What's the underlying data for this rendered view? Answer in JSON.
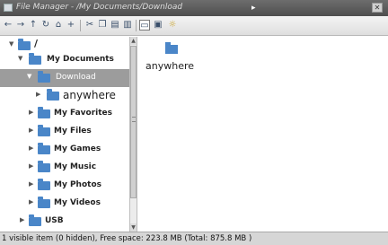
{
  "window": {
    "title": "File Manager - /My Documents/Download",
    "close_glyph": "✕",
    "app_icon": "folder-window-icon"
  },
  "toolbar": {
    "buttons": [
      {
        "name": "back-button",
        "glyph": "←"
      },
      {
        "name": "forward-button",
        "glyph": "→"
      },
      {
        "name": "up-button",
        "glyph": "↑"
      },
      {
        "name": "refresh-button",
        "glyph": "↻"
      },
      {
        "name": "home-button",
        "glyph": "⌂"
      },
      {
        "name": "new-folder-button",
        "glyph": "+"
      },
      {
        "name": "cut-button",
        "glyph": "✂"
      },
      {
        "name": "copy-button",
        "glyph": "❐"
      },
      {
        "name": "paste-button",
        "glyph": "▤"
      },
      {
        "name": "delete-button",
        "glyph": "▥"
      },
      {
        "name": "view-mode-button",
        "glyph": "▭"
      },
      {
        "name": "view-list-button",
        "glyph": "▣"
      },
      {
        "name": "hint-button",
        "glyph": "☼"
      }
    ]
  },
  "tree": [
    {
      "label": "/",
      "expanded": true,
      "icon": "folder-icon"
    },
    {
      "label": "My Documents",
      "expanded": true,
      "icon": "folder-icon"
    },
    {
      "label": "Download",
      "expanded": true,
      "selected": true,
      "icon": "folder-icon"
    },
    {
      "label": "anywhere",
      "expanded": false,
      "icon": "folder-icon"
    },
    {
      "label": "My Favorites",
      "expanded": false,
      "icon": "folder-icon"
    },
    {
      "label": "My Files",
      "expanded": false,
      "icon": "folder-icon"
    },
    {
      "label": "My Games",
      "expanded": false,
      "icon": "folder-icon"
    },
    {
      "label": "My Music",
      "expanded": false,
      "icon": "folder-icon"
    },
    {
      "label": "My Photos",
      "expanded": false,
      "icon": "folder-icon"
    },
    {
      "label": "My Videos",
      "expanded": false,
      "icon": "folder-icon"
    },
    {
      "label": "USB",
      "expanded": false,
      "icon": "folder-icon"
    }
  ],
  "content": {
    "items": [
      {
        "label": "anywhere",
        "icon": "folder-icon"
      }
    ]
  },
  "status": {
    "text": "1 visible item (0 hidden), Free space: 223.8 MB (Total: 875.8 MB )"
  },
  "colors": {
    "selection": "#9c9c9c",
    "folder": "#4a86c8",
    "titlebar": "#5a5a5a"
  }
}
